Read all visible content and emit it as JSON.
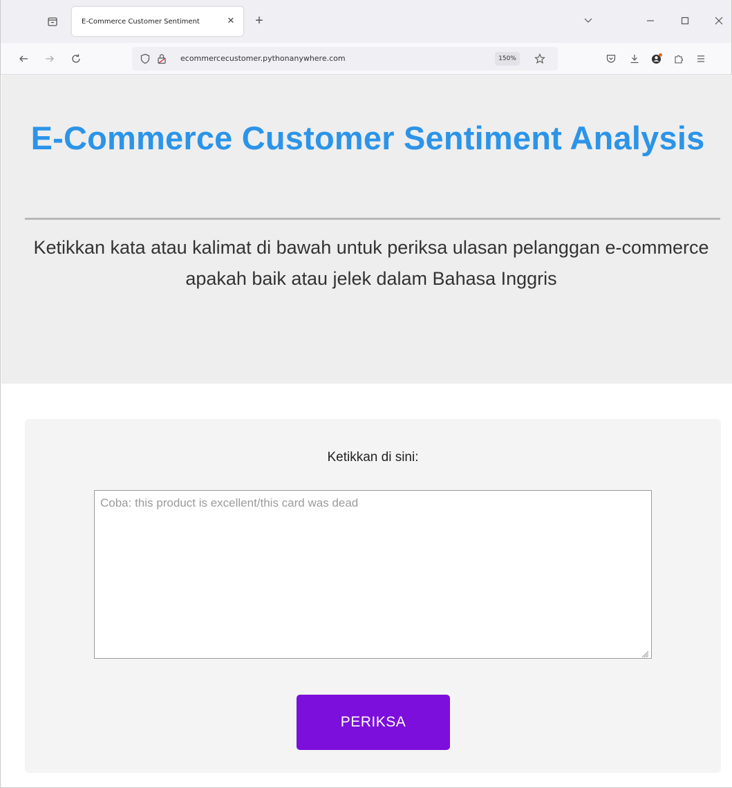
{
  "browser": {
    "tab_title": "E-Commerce Customer Sentiment",
    "tab_close": "✕",
    "new_tab": "+",
    "url": "ecommercecustomer.pythonanywhere.com",
    "zoom": "150%"
  },
  "page": {
    "title": "E-Commerce Customer Sentiment Analysis",
    "subtitle": "Ketikkan kata atau kalimat di bawah untuk periksa ulasan pelanggan e-commerce apakah baik atau jelek dalam Bahasa Inggris",
    "input_label": "Ketikkan di sini:",
    "input_placeholder": "Coba: this product is excellent/this card was dead",
    "input_value": "",
    "submit_label": "PERIKSA"
  },
  "colors": {
    "title": "#2b94e8",
    "button": "#7c0fdb",
    "header_bg": "#eeeeee",
    "card_bg": "#f4f4f4"
  },
  "icons": [
    "tab-list-icon",
    "chevron-down-icon",
    "minimize-icon",
    "maximize-icon",
    "close-icon",
    "back-arrow-icon",
    "forward-arrow-icon",
    "reload-icon",
    "shield-icon",
    "lock-icon",
    "star-icon",
    "pocket-icon",
    "download-icon",
    "account-icon",
    "extensions-icon",
    "menu-icon"
  ]
}
